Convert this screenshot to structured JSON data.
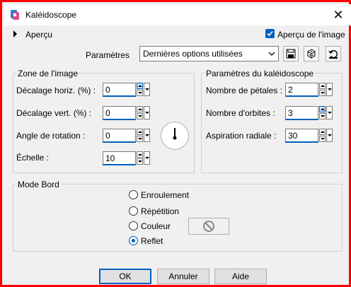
{
  "window": {
    "title": "Kaléidoscope",
    "close_icon": "close-icon"
  },
  "preview": {
    "label": "Aperçu",
    "checkbox_label": "Aperçu de l'image",
    "checked": true
  },
  "parameters": {
    "label": "Paramètres",
    "selected": "Dernières options utilisées"
  },
  "image_zone": {
    "title": "Zone de l'image",
    "h_offset": {
      "label": "Décalage horiz. (%) :",
      "value": "0"
    },
    "v_offset": {
      "label": "Décalage vert. (%) :",
      "value": "0"
    },
    "rotation": {
      "label": "Angle de rotation :",
      "value": "0"
    },
    "scale": {
      "label": "Échelle :",
      "value": "10"
    }
  },
  "kaleidoscope": {
    "title": "Paramètres du kaléidoscope",
    "petals": {
      "label": "Nombre de pétales :",
      "value": "2"
    },
    "orbits": {
      "label": "Nombre d'orbites :",
      "value": "3"
    },
    "radial": {
      "label": "Aspiration radiale :",
      "value": "30"
    }
  },
  "edge_mode": {
    "title": "Mode Bord",
    "options": [
      "Enroulement",
      "Répétition",
      "Couleur",
      "Reflet"
    ],
    "selected": "Reflet"
  },
  "buttons": {
    "ok": "OK",
    "cancel": "Annuler",
    "help": "Aide"
  },
  "colors": {
    "accent": "#0060c0",
    "frame": "#ff0000"
  }
}
